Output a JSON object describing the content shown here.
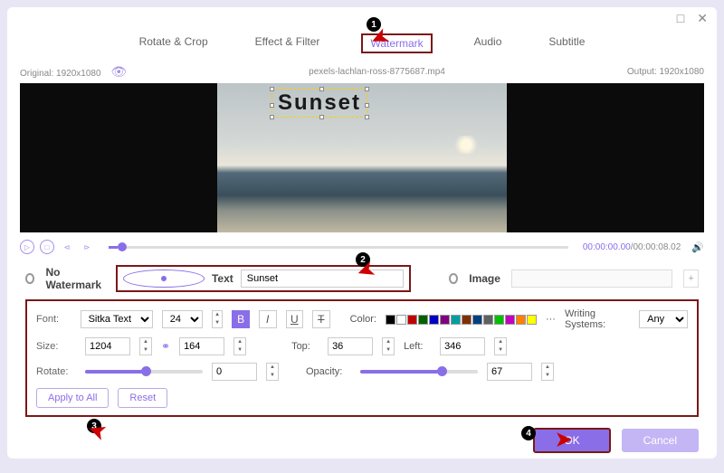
{
  "titlebar": {
    "max": "□",
    "close": "✕"
  },
  "tabs": {
    "rotate": "Rotate & Crop",
    "effect": "Effect & Filter",
    "watermark": "Watermark",
    "audio": "Audio",
    "subtitle": "Subtitle"
  },
  "info": {
    "original_label": "Original:",
    "original_res": "1920x1080",
    "filename": "pexels-lachlan-ross-8775687.mp4",
    "output_label": "Output:",
    "output_res": "1920x1080"
  },
  "watermark_text": "Sunset",
  "time": {
    "cur": "00:00:00.00",
    "sep": "/",
    "dur": "00:00:08.02"
  },
  "options": {
    "none": "No Watermark",
    "text": "Text",
    "text_value": "Sunset",
    "image": "Image",
    "add": "+"
  },
  "panel": {
    "font_label": "Font:",
    "font_family": "Sitka Text",
    "font_size": "24",
    "bold": "B",
    "italic": "I",
    "underline": "U",
    "strike": "T",
    "color_label": "Color:",
    "colors": [
      "#000000",
      "#ffffff",
      "#c00000",
      "#006000",
      "#0000c0",
      "#800080",
      "#00a0a0",
      "#803000",
      "#004080",
      "#606060",
      "#00c000",
      "#c000c0",
      "#ff8000",
      "#ffff00"
    ],
    "more": "···",
    "writing_label": "Writing Systems:",
    "writing_value": "Any",
    "size_label": "Size:",
    "size_w": "1204",
    "size_h": "164",
    "top_label": "Top:",
    "top_v": "36",
    "left_label": "Left:",
    "left_v": "346",
    "rotate_label": "Rotate:",
    "rotate_v": "0",
    "opacity_label": "Opacity:",
    "opacity_v": "67",
    "apply": "Apply to All",
    "reset": "Reset"
  },
  "footer": {
    "ok": "OK",
    "cancel": "Cancel"
  },
  "callouts": {
    "c1": "1",
    "c2": "2",
    "c3": "3",
    "c4": "4"
  }
}
